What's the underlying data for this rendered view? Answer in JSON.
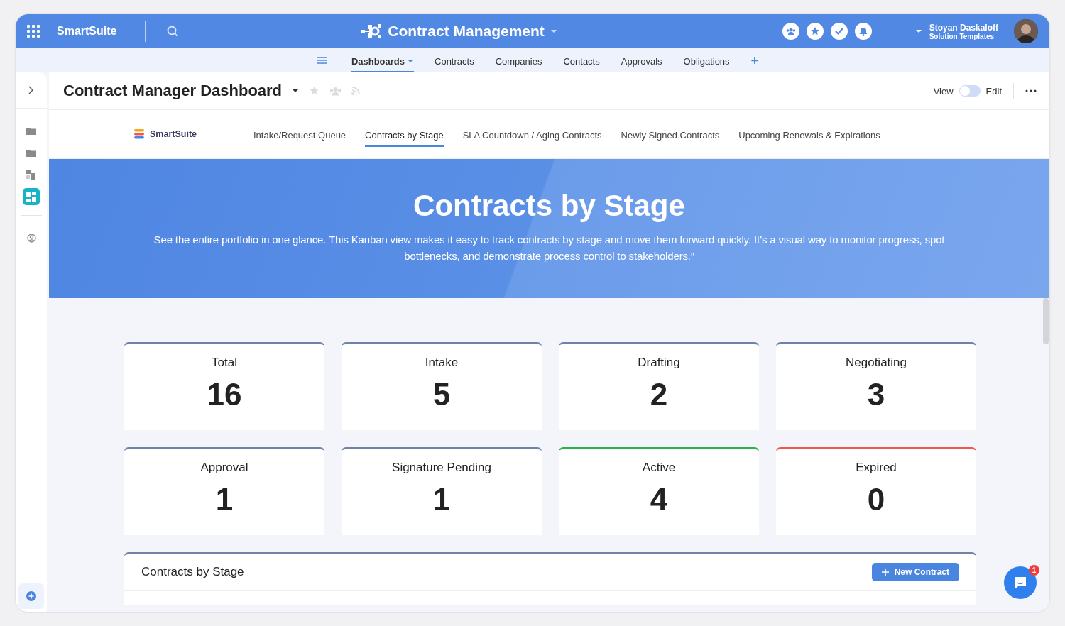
{
  "topbar": {
    "brand": "SmartSuite",
    "title": "Contract Management",
    "user_name": "Stoyan Daskaloff",
    "user_role": "Solution Templates"
  },
  "nav": [
    {
      "label": "Dashboards",
      "selected": true,
      "dropdown": true
    },
    {
      "label": "Contracts",
      "selected": false
    },
    {
      "label": "Companies",
      "selected": false
    },
    {
      "label": "Contacts",
      "selected": false
    },
    {
      "label": "Approvals",
      "selected": false
    },
    {
      "label": "Obligations",
      "selected": false
    },
    {
      "label": "+",
      "selected": false
    }
  ],
  "sidebar": {
    "items": [
      {
        "kind": "folder",
        "selected": false
      },
      {
        "kind": "folder",
        "selected": false
      },
      {
        "kind": "blocks",
        "selected": false
      },
      {
        "kind": "dashboard",
        "selected": true
      },
      {
        "kind": "person",
        "selected": false
      }
    ]
  },
  "header": {
    "title": "Contract Manager Dashboard",
    "view_label": "View",
    "edit_label": "Edit",
    "edit_mode": false
  },
  "dashboard_tabs": {
    "logo": "SmartSuite",
    "tabs": [
      {
        "label": "Intake/Request Queue",
        "selected": false
      },
      {
        "label": "Contracts by Stage",
        "selected": true
      },
      {
        "label": "SLA Countdown / Aging Contracts",
        "selected": false
      },
      {
        "label": "Newly Signed Contracts",
        "selected": false
      },
      {
        "label": "Upcoming Renewals & Expirations",
        "selected": false
      }
    ]
  },
  "hero": {
    "title": "Contracts by Stage",
    "text": "See the entire portfolio in one glance. This Kanban view makes it easy to track contracts by stage and move them forward quickly. It’s a visual way to monitor progress, spot bottlenecks, and demonstrate process control to stakeholders.”"
  },
  "stats": [
    {
      "label": "Total",
      "value": "16",
      "color": "#6f83a6"
    },
    {
      "label": "Intake",
      "value": "5",
      "color": "#6f83a6"
    },
    {
      "label": "Drafting",
      "value": "2",
      "color": "#6f83a6"
    },
    {
      "label": "Negotiating",
      "value": "3",
      "color": "#6f83a6"
    },
    {
      "label": "Approval",
      "value": "1",
      "color": "#6f83a6"
    },
    {
      "label": "Signature Pending",
      "value": "1",
      "color": "#6f83a6"
    },
    {
      "label": "Active",
      "value": "4",
      "color": "#2bb24c"
    },
    {
      "label": "Expired",
      "value": "0",
      "color": "#f2574f"
    }
  ],
  "panel": {
    "title": "Contracts by Stage",
    "button": "New Contract"
  },
  "chat": {
    "badge": "1"
  }
}
